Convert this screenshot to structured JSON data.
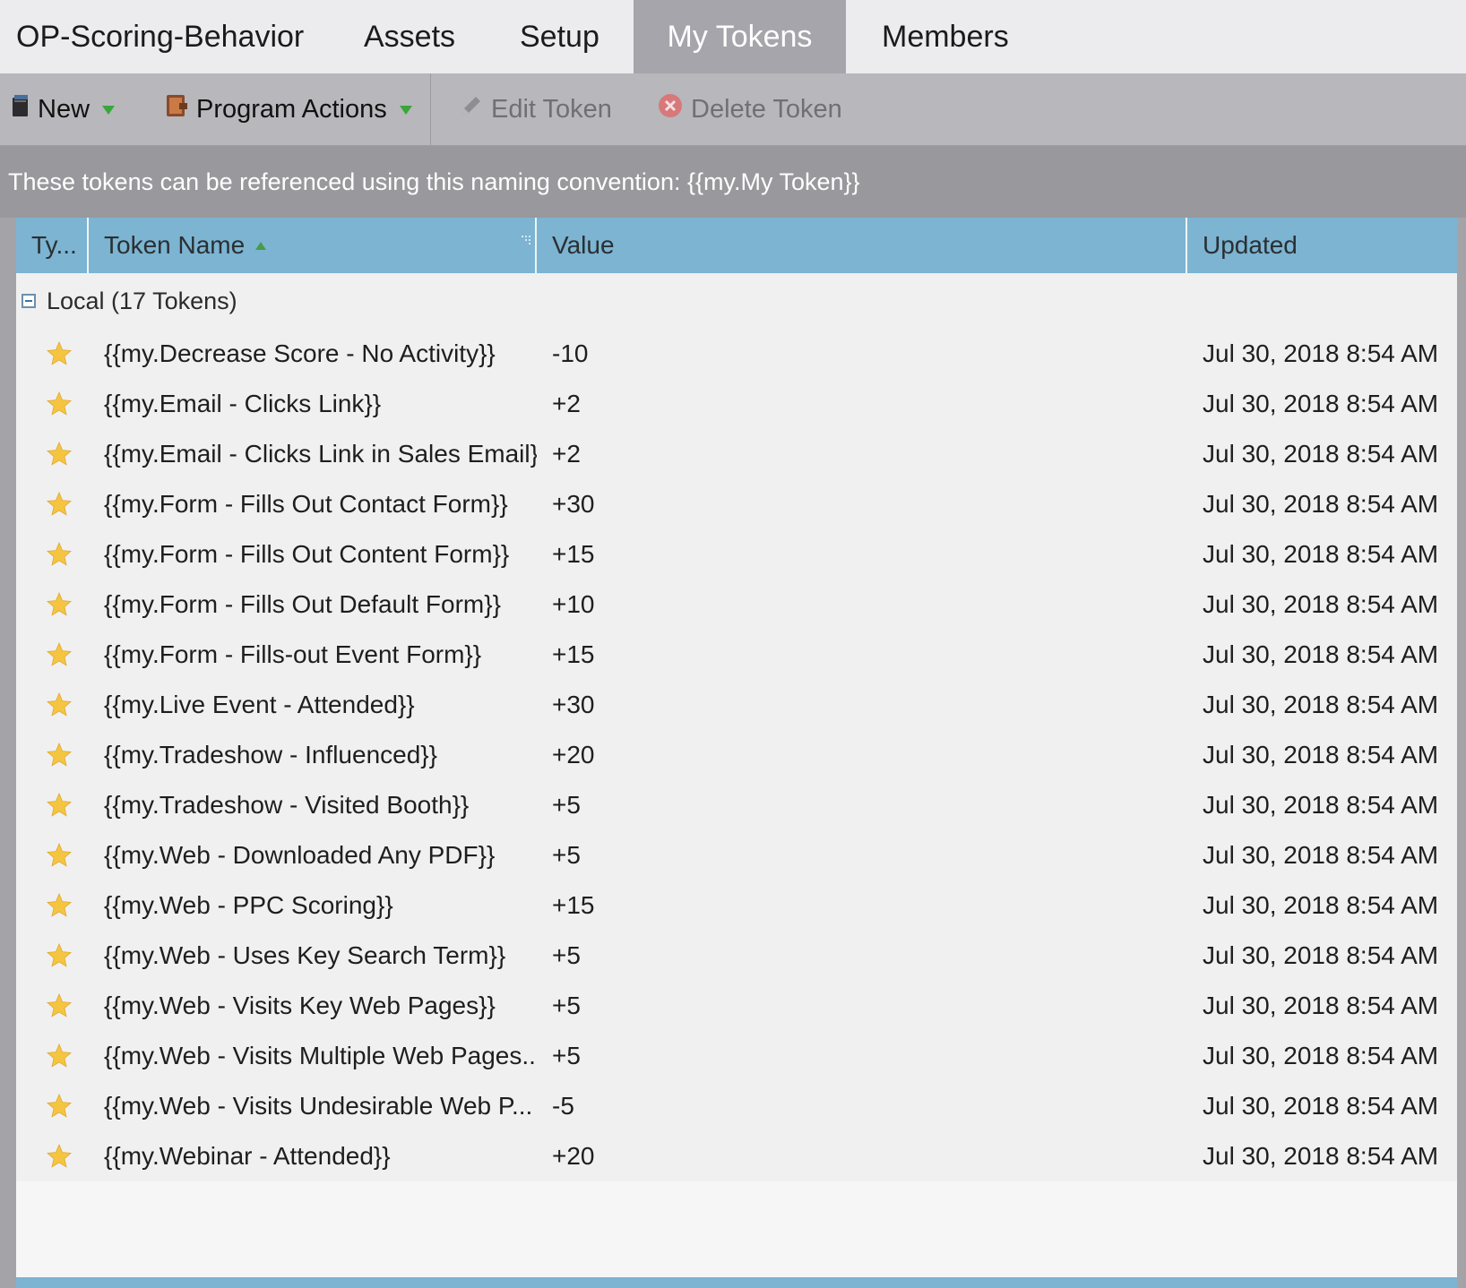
{
  "tabs": [
    {
      "label": "OP-Scoring-Behavior"
    },
    {
      "label": "Assets"
    },
    {
      "label": "Setup"
    },
    {
      "label": "My Tokens"
    },
    {
      "label": "Members"
    }
  ],
  "active_tab": "My Tokens",
  "toolbar": {
    "new_label": "New",
    "program_actions_label": "Program Actions",
    "edit_token_label": "Edit Token",
    "delete_token_label": "Delete Token"
  },
  "info_text": "These tokens can be referenced using this naming convention: {{my.My Token}}",
  "grid": {
    "columns": {
      "type": "Ty...",
      "name": "Token Name",
      "value": "Value",
      "updated": "Updated"
    },
    "sort": {
      "column": "Token Name",
      "direction": "ascending"
    },
    "group_label": "Local (17 Tokens)",
    "rows": [
      {
        "icon": "star-icon",
        "name": "{{my.Decrease Score - No Activity}}",
        "value": "-10",
        "updated": "Jul 30, 2018 8:54 AM"
      },
      {
        "icon": "star-icon",
        "name": "{{my.Email - Clicks Link}}",
        "value": "+2",
        "updated": "Jul 30, 2018 8:54 AM"
      },
      {
        "icon": "star-icon",
        "name": "{{my.Email - Clicks Link in Sales Email}}",
        "value": "+2",
        "updated": "Jul 30, 2018 8:54 AM"
      },
      {
        "icon": "star-icon",
        "name": "{{my.Form - Fills Out Contact Form}}",
        "value": "+30",
        "updated": "Jul 30, 2018 8:54 AM"
      },
      {
        "icon": "star-icon",
        "name": "{{my.Form - Fills Out Content Form}}",
        "value": "+15",
        "updated": "Jul 30, 2018 8:54 AM"
      },
      {
        "icon": "star-icon",
        "name": "{{my.Form - Fills Out Default Form}}",
        "value": "+10",
        "updated": "Jul 30, 2018 8:54 AM"
      },
      {
        "icon": "star-icon",
        "name": "{{my.Form - Fills-out Event Form}}",
        "value": "+15",
        "updated": "Jul 30, 2018 8:54 AM"
      },
      {
        "icon": "star-icon",
        "name": "{{my.Live Event - Attended}}",
        "value": "+30",
        "updated": "Jul 30, 2018 8:54 AM"
      },
      {
        "icon": "star-icon",
        "name": "{{my.Tradeshow - Influenced}}",
        "value": "+20",
        "updated": "Jul 30, 2018 8:54 AM"
      },
      {
        "icon": "star-icon",
        "name": "{{my.Tradeshow - Visited Booth}}",
        "value": "+5",
        "updated": "Jul 30, 2018 8:54 AM"
      },
      {
        "icon": "star-icon",
        "name": "{{my.Web - Downloaded Any PDF}}",
        "value": "+5",
        "updated": "Jul 30, 2018 8:54 AM"
      },
      {
        "icon": "star-icon",
        "name": "{{my.Web - PPC Scoring}}",
        "value": "+15",
        "updated": "Jul 30, 2018 8:54 AM"
      },
      {
        "icon": "star-icon",
        "name": "{{my.Web - Uses Key Search Term}}",
        "value": "+5",
        "updated": "Jul 30, 2018 8:54 AM"
      },
      {
        "icon": "star-icon",
        "name": "{{my.Web - Visits Key Web Pages}}",
        "value": "+5",
        "updated": "Jul 30, 2018 8:54 AM"
      },
      {
        "icon": "star-icon",
        "name": "{{my.Web - Visits Multiple Web Pages...",
        "value": "+5",
        "updated": "Jul 30, 2018 8:54 AM"
      },
      {
        "icon": "star-icon",
        "name": "{{my.Web - Visits Undesirable Web P...",
        "value": "-5",
        "updated": "Jul 30, 2018 8:54 AM"
      },
      {
        "icon": "star-icon",
        "name": "{{my.Webinar - Attended}}",
        "value": "+20",
        "updated": "Jul 30, 2018 8:54 AM"
      }
    ]
  },
  "colors": {
    "header_blue": "#7cb4d1",
    "active_tab_bg": "#a5a5ab",
    "toolbar_bg": "#b7b7bc",
    "info_bg": "#98989d",
    "star": "#f5c542"
  }
}
